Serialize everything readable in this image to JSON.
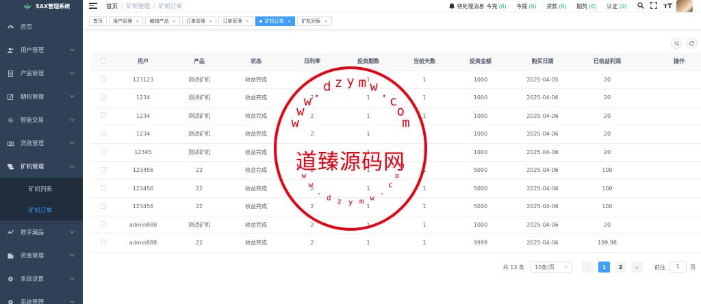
{
  "app": {
    "title": "SAX管理系统"
  },
  "sidebar": {
    "items": [
      {
        "label": "首页",
        "icon": "dashboard-icon"
      },
      {
        "label": "用户管理",
        "icon": "user-icon"
      },
      {
        "label": "产品管理",
        "icon": "document-icon"
      },
      {
        "label": "期权管理",
        "icon": "edit-icon"
      },
      {
        "label": "智能交易",
        "icon": "gear-icon"
      },
      {
        "label": "贷款管理",
        "icon": "money-icon"
      },
      {
        "label": "矿机管理",
        "icon": "stack-icon"
      },
      {
        "label": "数字藏品",
        "icon": "chart-icon"
      },
      {
        "label": "资金管理",
        "icon": "wallet-icon"
      },
      {
        "label": "系统设置",
        "icon": "settings-icon"
      },
      {
        "label": "系统管理",
        "icon": "system-icon"
      }
    ],
    "submenu": [
      {
        "label": "矿机列表"
      },
      {
        "label": "矿机订单"
      }
    ]
  },
  "breadcrumb": [
    "首页",
    "矿机管理",
    "矿机订单"
  ],
  "header": {
    "pending_label": "待处理消息",
    "items": [
      {
        "label": "今充",
        "count": "(0)"
      },
      {
        "label": "今提",
        "count": "(0)"
      },
      {
        "label": "贷款",
        "count": "(0)"
      },
      {
        "label": "期货",
        "count": "(0)"
      },
      {
        "label": "认证",
        "count": "(0)"
      }
    ],
    "font_size_icon": "тT"
  },
  "tags": [
    {
      "label": "首页",
      "closable": false
    },
    {
      "label": "用户管理",
      "closable": true
    },
    {
      "label": "编辑产品",
      "closable": true
    },
    {
      "label": "订单管理",
      "closable": true
    },
    {
      "label": "订单管理",
      "closable": true
    },
    {
      "label": "矿机订单",
      "closable": true,
      "active": true
    },
    {
      "label": "矿机列表",
      "closable": true
    }
  ],
  "table": {
    "columns": [
      "用户",
      "产品",
      "状态",
      "日利率",
      "投资期数",
      "当前天数",
      "投资金额",
      "购买日期",
      "已收益利润",
      "操作"
    ],
    "rows": [
      [
        "123123",
        "测试矿机",
        "收益完成",
        "2",
        "1",
        "1",
        "1000",
        "2025-04-05",
        "20",
        ""
      ],
      [
        "1234",
        "测试矿机",
        "收益完成",
        "2",
        "1",
        "1",
        "1000",
        "2025-04-06",
        "20",
        ""
      ],
      [
        "1234",
        "测试矿机",
        "收益完成",
        "2",
        "1",
        "1",
        "1000",
        "2025-04-06",
        "20",
        ""
      ],
      [
        "1234",
        "测试矿机",
        "收益完成",
        "2",
        "1",
        "1",
        "1000",
        "2025-04-06",
        "20",
        ""
      ],
      [
        "12345",
        "测试矿机",
        "收益完成",
        "2",
        "1",
        "1",
        "1000",
        "2025-04-06",
        "20",
        ""
      ],
      [
        "123456",
        "22",
        "收益完成",
        "2",
        "1",
        "1",
        "5000",
        "2025-04-06",
        "100",
        ""
      ],
      [
        "123456",
        "22",
        "收益完成",
        "2",
        "1",
        "1",
        "5000",
        "2025-04-06",
        "100",
        ""
      ],
      [
        "123456",
        "22",
        "收益完成",
        "2",
        "1",
        "1",
        "5000",
        "2025-04-06",
        "100",
        ""
      ],
      [
        "admin888",
        "测试矿机",
        "收益完成",
        "2",
        "1",
        "1",
        "1000",
        "2025-04-06",
        "20",
        ""
      ],
      [
        "admin888",
        "22",
        "收益完成",
        "2",
        "1",
        "1",
        "9999",
        "2025-04-06",
        "199.98",
        ""
      ]
    ]
  },
  "pagination": {
    "total": "共 13 条",
    "page_size": "10条/页",
    "pages": [
      "1",
      "2"
    ],
    "current": "1",
    "goto_label": "前往",
    "goto_value": "1",
    "page_suffix": "页"
  },
  "watermark": {
    "center_text": "道臻源码网",
    "ring_text": "www.dzymw.com"
  },
  "colors": {
    "sidebar_bg": "#304156",
    "accent": "#409eff",
    "green": "#13ce66",
    "stamp_red": "#e60012"
  }
}
